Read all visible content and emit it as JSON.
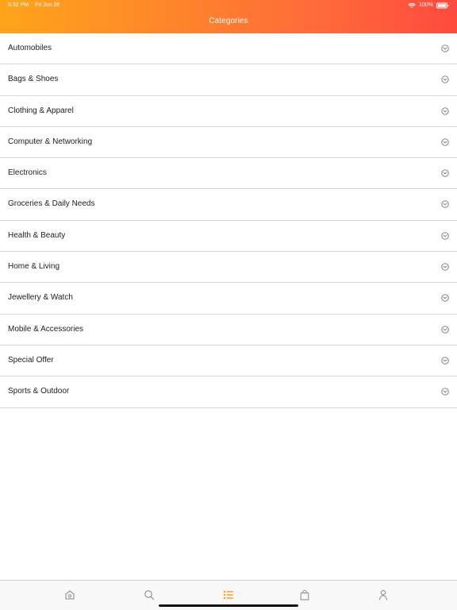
{
  "status_bar": {
    "time": "5:32 PM",
    "date": "Fri Jun 26",
    "battery": "100%"
  },
  "header": {
    "title": "Categories"
  },
  "categories": [
    {
      "label": "Automobiles"
    },
    {
      "label": "Bags & Shoes"
    },
    {
      "label": "Clothing & Apparel"
    },
    {
      "label": "Computer & Networking"
    },
    {
      "label": "Electronics"
    },
    {
      "label": "Groceries & Daily Needs"
    },
    {
      "label": "Health & Beauty"
    },
    {
      "label": "Home & Living"
    },
    {
      "label": "Jewellery & Watch"
    },
    {
      "label": "Mobile & Accessories"
    },
    {
      "label": "Special Offer"
    },
    {
      "label": "Sports & Outdoor"
    }
  ],
  "tabs": [
    {
      "name": "home",
      "icon": "home-icon"
    },
    {
      "name": "search",
      "icon": "search-icon"
    },
    {
      "name": "categories",
      "icon": "list-icon",
      "active": true
    },
    {
      "name": "cart",
      "icon": "shopping-bag-icon"
    },
    {
      "name": "account",
      "icon": "user-icon"
    }
  ],
  "colors": {
    "header_gradient_start": "#ffa51a",
    "header_gradient_end": "#ff4a3f",
    "active_tab": "#ff9b1b",
    "inactive_tab": "#9a9a9a"
  }
}
